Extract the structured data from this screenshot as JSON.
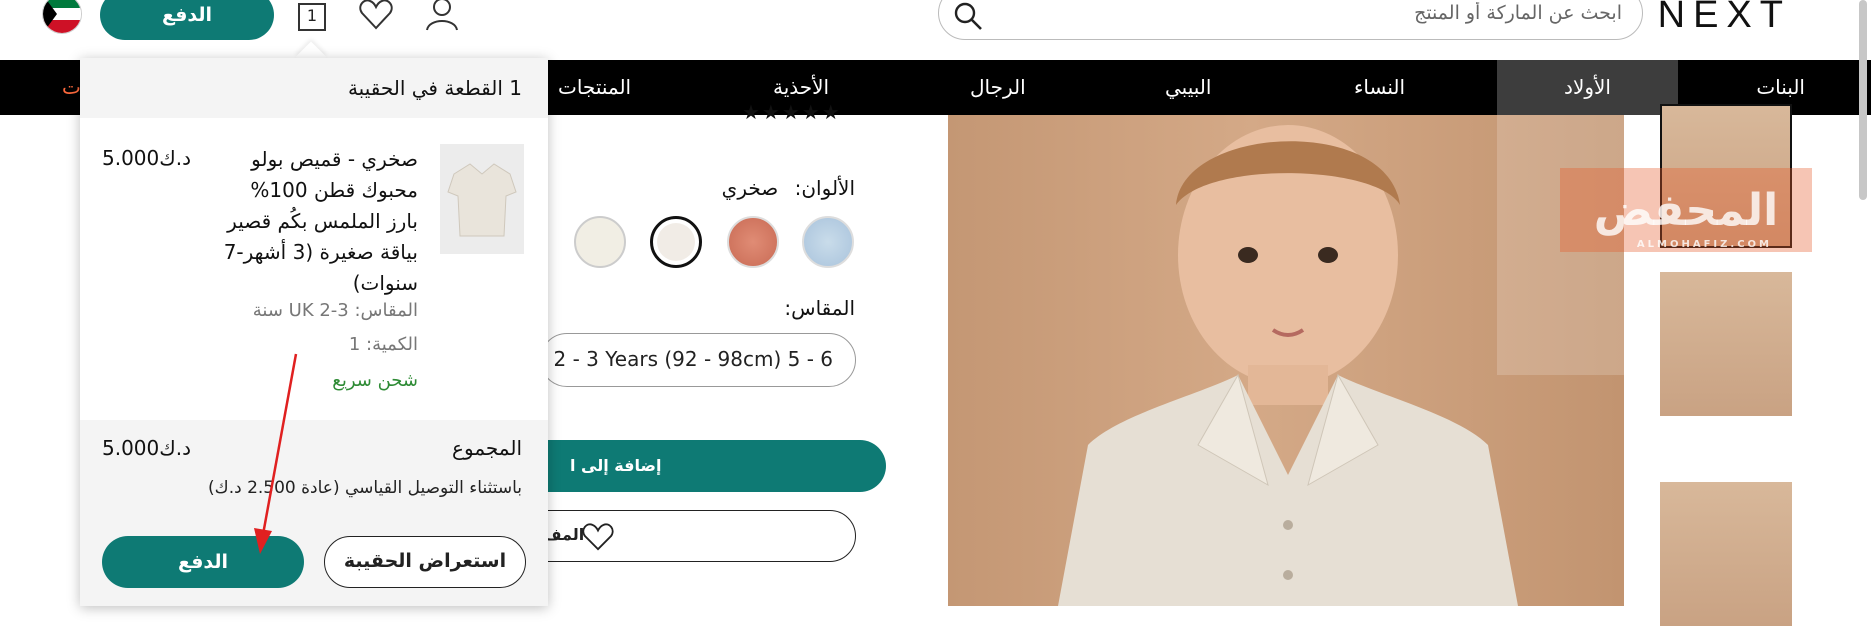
{
  "header": {
    "logo": "NEXT",
    "search_placeholder": "ابحث عن الماركة أو المنتج",
    "pay_button": "الدفع",
    "bag_count": "1"
  },
  "nav": {
    "items": [
      "البنات",
      "الأولاد",
      "النساء",
      "البيبي",
      "الرجال",
      "الأحذية",
      "المنتجات",
      "ت"
    ],
    "active_index": 1
  },
  "product": {
    "colours_label": "الألوان:",
    "colour_selected": "صخري",
    "size_label": "المقاس:",
    "size_value": "2 - 3 Years (92 - 98cm) 5 - 6",
    "add_to_bag": "إضافة إلى ا",
    "favourite": "المف"
  },
  "watermark": {
    "text": "المحفض",
    "sub": "ALMOHAFIZ.COM"
  },
  "bag": {
    "heading": "1 القطعة في الحقيبة",
    "item_title": "صخري - قميص بولو محبوك قطن 100% بارز الملمس بكُم قصير بياقة صغيرة (3 أشهر-7 سنوات)",
    "item_price": "5.000د.ك",
    "size": "المقاس: UK 2-3 سنة",
    "quantity": "الكمية: 1",
    "shipping": "شحن سريع",
    "total_label": "المجموع",
    "total_price": "5.000د.ك",
    "delivery_note": "باستثناء التوصيل القياسي (عادة 2.500 د.ك)",
    "view_bag": "استعراض الحقيبة",
    "checkout": "الدفع"
  },
  "colors": {
    "accent": "#0e7a74",
    "sale": "#ff6a3d",
    "shipping": "#2e8b35"
  }
}
